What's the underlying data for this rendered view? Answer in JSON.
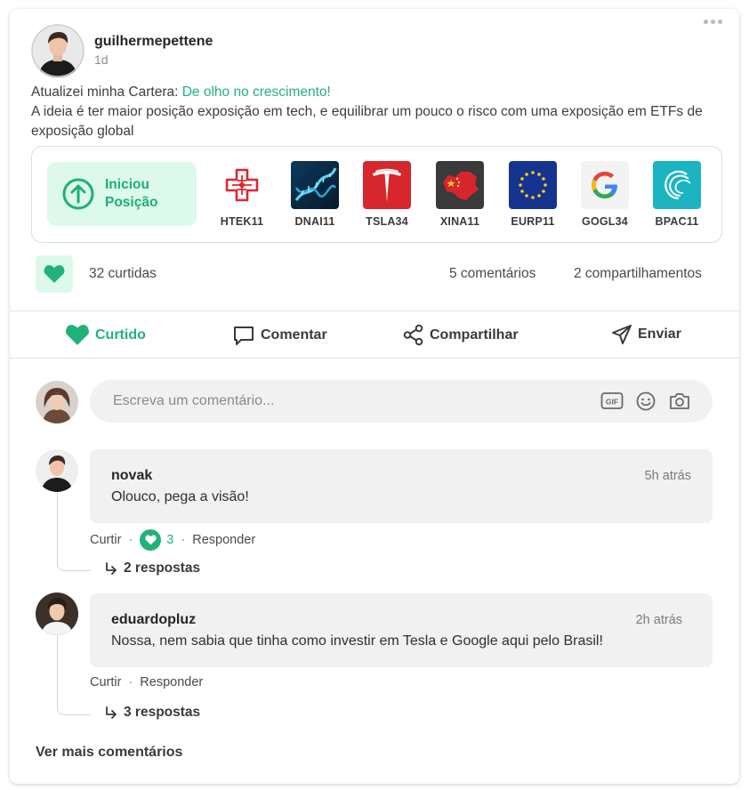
{
  "post": {
    "author": "guilhermepettene",
    "time": "1d",
    "intro": "Atualizei minha Cartera: ",
    "portfolio_name": "De olho no crescimento!",
    "body": "A ideia é ter maior posição exposição em tech, e equilibrar um pouco o risco com uma exposição em ETFs de exposição global"
  },
  "portfolio": {
    "action_label_line1": "Iniciou",
    "action_label_line2": "Posição",
    "assets": [
      {
        "ticker": "HTEK11",
        "icon": "medical-cross-logo"
      },
      {
        "ticker": "DNAI11",
        "icon": "dna-logo"
      },
      {
        "ticker": "TSLA34",
        "icon": "tesla-logo"
      },
      {
        "ticker": "XINA11",
        "icon": "china-map-logo"
      },
      {
        "ticker": "EURP11",
        "icon": "eu-flag-logo"
      },
      {
        "ticker": "GOGL34",
        "icon": "google-logo"
      },
      {
        "ticker": "BPAC11",
        "icon": "btg-logo"
      }
    ]
  },
  "stats": {
    "likes": "32 curtidas",
    "comments": "5 comentários",
    "shares": "2 compartilhamentos"
  },
  "actions": {
    "like": "Curtido",
    "comment": "Comentar",
    "share": "Compartilhar",
    "send": "Enviar"
  },
  "comment_box": {
    "placeholder": "Escreva um comentário..."
  },
  "comments": [
    {
      "author": "novak",
      "time": "5h atrás",
      "text": "Olouco, pega a visão!",
      "like_label": "Curtir",
      "like_count": "3",
      "reply_label": "Responder",
      "replies": "2 respostas"
    },
    {
      "author": "eduardopluz",
      "time": "2h atrás",
      "text": "Nossa, nem sabia que tinha como investir em Tesla e Google aqui pelo Brasil!",
      "like_label": "Curtir",
      "reply_label": "Responder",
      "replies": "3 respostas"
    }
  ],
  "footer": {
    "more_comments": "Ver mais comentários"
  },
  "colors": {
    "accent": "#21b27a",
    "accent_light": "#dcf9ec",
    "tesla_red": "#d7262e",
    "eu_blue": "#15338f",
    "btg_teal": "#1bb5c1"
  }
}
